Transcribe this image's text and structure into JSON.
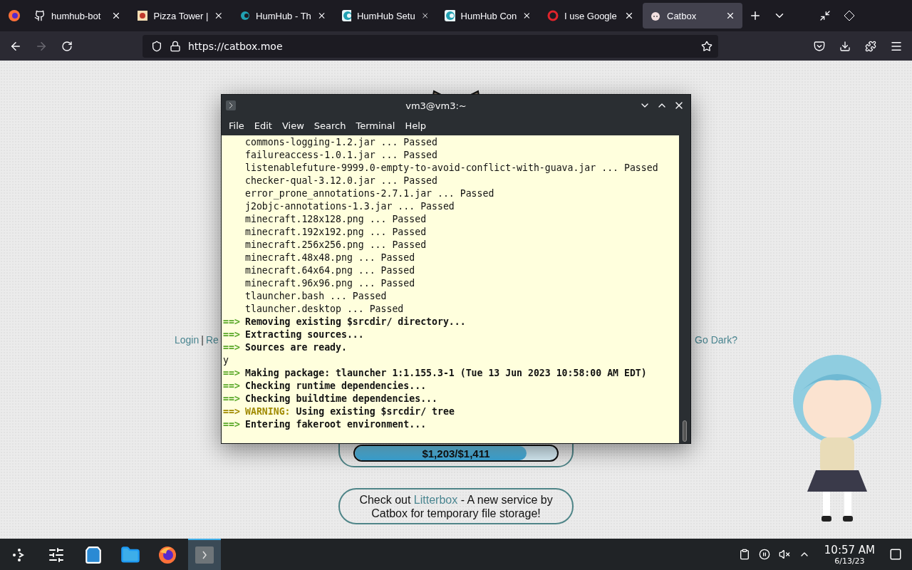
{
  "browser": {
    "tabs": [
      {
        "title": "humhub-bot",
        "selected": false
      },
      {
        "title": "Pizza Tower |",
        "selected": false
      },
      {
        "title": "HumHub - Th",
        "selected": false
      },
      {
        "title": "HumHub Setu",
        "selected": false
      },
      {
        "title": "HumHub Con",
        "selected": false
      },
      {
        "title": "I use Google",
        "selected": false
      },
      {
        "title": "Catbox",
        "selected": true
      }
    ],
    "forward_disabled": true,
    "url": "https://catbox.moe"
  },
  "page": {
    "account_links": [
      "Login",
      "Re"
    ],
    "separator": "|",
    "theme_toggle": "Go Dark?",
    "donation": {
      "reading": "$1,203/$1,411",
      "level": 0.85
    },
    "promo": {
      "before": "Check out ",
      "link": "Litterbox",
      "after": " - A new service by Catbox for temporary file storage!"
    }
  },
  "terminal": {
    "title": "vm3@vm3:~",
    "menu": [
      "File",
      "Edit",
      "View",
      "Search",
      "Terminal",
      "Help"
    ],
    "arrow": "==>",
    "warning_label": "WARNING:",
    "lines": [
      {
        "kind": "plain",
        "text": "commons-logging-1.2.jar ... Passed"
      },
      {
        "kind": "plain",
        "text": "failureaccess-1.0.1.jar ... Passed"
      },
      {
        "kind": "plain",
        "text": "listenablefuture-9999.0-empty-to-avoid-conflict-with-guava.jar ... Passed"
      },
      {
        "kind": "plain",
        "text": "checker-qual-3.12.0.jar ... Passed"
      },
      {
        "kind": "plain",
        "text": "error_prone_annotations-2.7.1.jar ... Passed"
      },
      {
        "kind": "plain",
        "text": "j2objc-annotations-1.3.jar ... Passed"
      },
      {
        "kind": "plain",
        "text": "minecraft.128x128.png ... Passed"
      },
      {
        "kind": "plain",
        "text": "minecraft.192x192.png ... Passed"
      },
      {
        "kind": "plain",
        "text": "minecraft.256x256.png ... Passed"
      },
      {
        "kind": "plain",
        "text": "minecraft.48x48.png ... Passed"
      },
      {
        "kind": "plain",
        "text": "minecraft.64x64.png ... Passed"
      },
      {
        "kind": "plain",
        "text": "minecraft.96x96.png ... Passed"
      },
      {
        "kind": "plain",
        "text": "tlauncher.bash ... Passed"
      },
      {
        "kind": "plain",
        "text": "tlauncher.desktop ... Passed"
      },
      {
        "kind": "step",
        "text": "Removing existing $srcdir/ directory..."
      },
      {
        "kind": "step",
        "text": "Extracting sources..."
      },
      {
        "kind": "step",
        "text": "Sources are ready."
      },
      {
        "kind": "input",
        "text": "y"
      },
      {
        "kind": "step",
        "text": "Making package: tlauncher 1:1.155.3-1 (Tue 13 Jun 2023 10:58:00 AM EDT)"
      },
      {
        "kind": "step",
        "text": "Checking runtime dependencies..."
      },
      {
        "kind": "step",
        "text": "Checking buildtime dependencies..."
      },
      {
        "kind": "warning",
        "text": "Using existing $srcdir/ tree"
      },
      {
        "kind": "step",
        "text": "Entering fakeroot environment..."
      }
    ]
  },
  "taskbar": {
    "apps": [
      {
        "selected": false
      },
      {
        "selected": false
      },
      {
        "selected": false
      },
      {
        "selected": false
      },
      {
        "selected": false
      },
      {
        "selected": true
      }
    ],
    "time": "10:57 AM",
    "date": "6/13/23"
  }
}
